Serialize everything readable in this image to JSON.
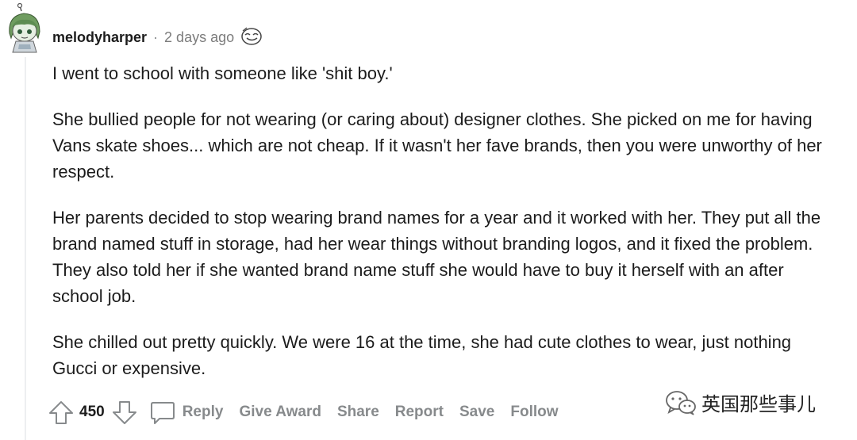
{
  "comment": {
    "username": "melodyharper",
    "separator": "·",
    "time_ago": "2 days ago",
    "avatar_icon": "snoo-avatar-icon",
    "award_icon": "award-icon",
    "paragraphs": [
      "I went to school with someone like 'shit boy.'",
      "She bullied people for not wearing (or caring about) designer clothes. She picked on me for having Vans skate shoes... which are not cheap. If it wasn't her fave brands, then you were unworthy of her respect.",
      "Her parents decided to stop wearing brand names for a year and it worked with her. They put all the brand named stuff in storage, had her wear things without branding logos, and it fixed the problem. They also told her if she wanted brand name stuff she would have to buy it herself with an after school job.",
      "She chilled out pretty quickly. We were 16 at the time, she had cute clothes to wear, just nothing Gucci or expensive."
    ]
  },
  "actions": {
    "score": "450",
    "reply": "Reply",
    "give_award": "Give Award",
    "share": "Share",
    "report": "Report",
    "save": "Save",
    "follow": "Follow"
  },
  "watermark": {
    "text": "英国那些事儿"
  },
  "colors": {
    "text": "#1c1c1c",
    "muted": "#878a8c",
    "thread_line": "#edeff1"
  }
}
